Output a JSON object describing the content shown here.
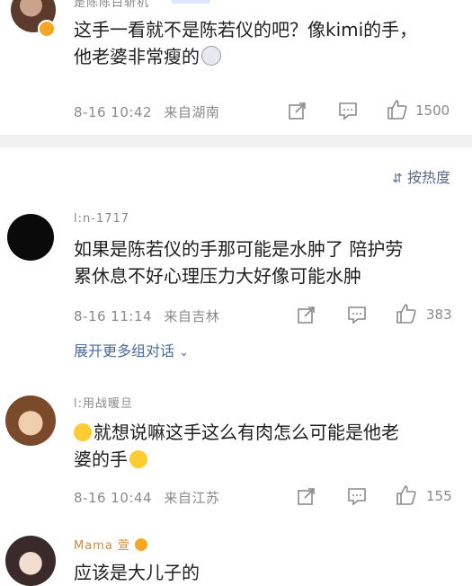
{
  "comments": [
    {
      "name": "是陈陈白斩机",
      "content_line1": "这手一看就不是陈若仪的吧？像kimi的手，",
      "content_line2": "他老婆非常瘦的",
      "time": "8-16 10:42",
      "location": "来自湖南",
      "likes": "1500"
    },
    {
      "name": "l:n-1717",
      "content_line1": "如果是陈若仪的手那可能是水肿了 陪护劳",
      "content_line2": "累休息不好心理压力大好像可能水肿",
      "time": "8-16 11:14",
      "location": "来自吉林",
      "likes": "383",
      "expand": "展开更多组对话"
    },
    {
      "name": "l:用战暖旦",
      "content_line1": "就想说嘛这手这么有肉怎么可能是他老",
      "content_line2": "婆的手",
      "time": "8-16 10:44",
      "location": "来自江苏",
      "likes": "155"
    },
    {
      "name": "Mama 萱",
      "content_line1": "应该是大儿子的"
    }
  ],
  "sort_label": "按热度",
  "colors": {
    "divider": "#f1f1f1",
    "link": "#4a6a9a",
    "meta": "#8a8a8a"
  }
}
